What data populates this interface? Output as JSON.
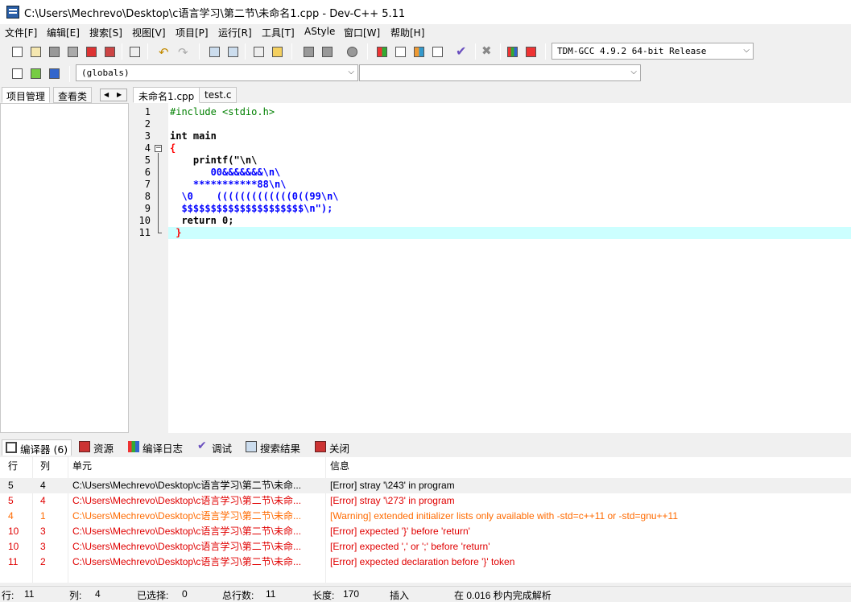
{
  "window": {
    "title": "C:\\Users\\Mechrevo\\Desktop\\c语言学习\\第二节\\未命名1.cpp - Dev-C++ 5.11"
  },
  "menu": [
    "文件[F]",
    "编辑[E]",
    "搜索[S]",
    "视图[V]",
    "项目[P]",
    "运行[R]",
    "工具[T]",
    "AStyle",
    "窗口[W]",
    "帮助[H]"
  ],
  "toolbar": {
    "compiler": "TDM-GCC 4.9.2 64-bit Release",
    "scope": "(globals)",
    "function": ""
  },
  "left_panel": {
    "tabs": [
      "项目管理",
      "查看类"
    ]
  },
  "editor": {
    "tabs": [
      "未命名1.cpp",
      "test.c"
    ],
    "line_numbers": [
      "1",
      "2",
      "3",
      "4",
      "5",
      "6",
      "7",
      "8",
      "9",
      "10",
      "11"
    ],
    "lines": [
      "#include <stdio.h>",
      "",
      "int main",
      "{",
      "    printf(\"\\n\\",
      "       00&&&&&&&\\n\\",
      "    ***********88\\n\\",
      "  \\0    (((((((((((((0((99\\n\\",
      "  $$$$$$$$$$$$$$$$$$$$$\\n\");",
      "  return 0;",
      " }"
    ]
  },
  "bottom_tabs": [
    "编译器 (6)",
    "资源",
    "编译日志",
    "调试",
    "搜索结果",
    "关闭"
  ],
  "messages": {
    "headers": [
      "行",
      "列",
      "单元",
      "信息"
    ],
    "rows": [
      {
        "line": "5",
        "col": "4",
        "unit": "C:\\Users\\Mechrevo\\Desktop\\c语言学习\\第二节\\未命...",
        "msg": "[Error] stray '\\243' in program",
        "color": "#000000"
      },
      {
        "line": "5",
        "col": "4",
        "unit": "C:\\Users\\Mechrevo\\Desktop\\c语言学习\\第二节\\未命...",
        "msg": "[Error] stray '\\273' in program",
        "color": "#e00000"
      },
      {
        "line": "4",
        "col": "1",
        "unit": "C:\\Users\\Mechrevo\\Desktop\\c语言学习\\第二节\\未命...",
        "msg": "[Warning] extended initializer lists only available with -std=c++11 or -std=gnu++11",
        "color": "#ff6a00"
      },
      {
        "line": "10",
        "col": "3",
        "unit": "C:\\Users\\Mechrevo\\Desktop\\c语言学习\\第二节\\未命...",
        "msg": "[Error] expected '}' before 'return'",
        "color": "#e00000"
      },
      {
        "line": "10",
        "col": "3",
        "unit": "C:\\Users\\Mechrevo\\Desktop\\c语言学习\\第二节\\未命...",
        "msg": "[Error] expected ',' or ';' before 'return'",
        "color": "#e00000"
      },
      {
        "line": "11",
        "col": "2",
        "unit": "C:\\Users\\Mechrevo\\Desktop\\c语言学习\\第二节\\未命...",
        "msg": "[Error] expected declaration before '}' token",
        "color": "#e00000"
      }
    ]
  },
  "status": {
    "row_label": "行:",
    "row": "11",
    "col_label": "列:",
    "col": "4",
    "sel_label": "已选择:",
    "sel": "0",
    "total_label": "总行数:",
    "total": "11",
    "len_label": "长度:",
    "len": "170",
    "mode": "插入",
    "parse": "在 0.016 秒内完成解析"
  }
}
